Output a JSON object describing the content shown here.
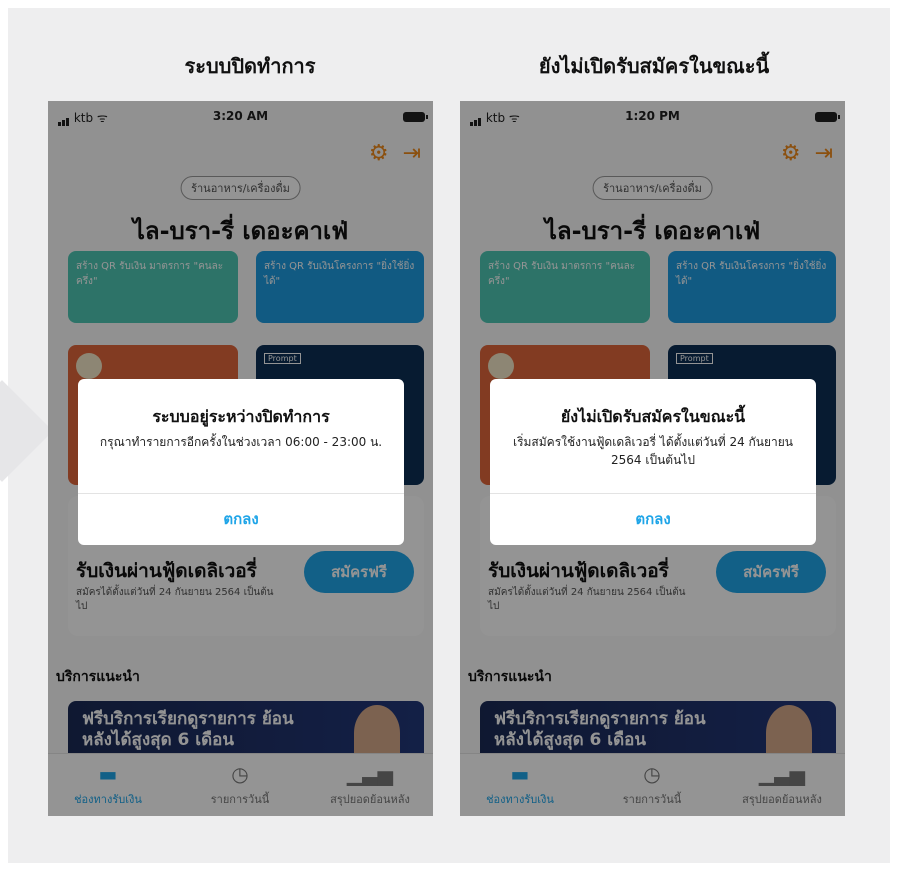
{
  "colors": {
    "accent": "#1fa5e8",
    "orange_icon": "#f08a1a",
    "overlay": "rgba(0,0,0,0.42)"
  },
  "panels": [
    {
      "caption": "ระบบปิดทำการ",
      "status": {
        "carrier": "ktb",
        "time": "3:20 AM"
      },
      "category": "ร้านอาหาร/เครื่องดื่ม",
      "shop_name": "ไล-บรา-รี่ เดอะคาเฟ่",
      "tiles": {
        "green_text": "สร้าง QR รับเงิน มาตรการ \"คนละครึ่ง\"",
        "blue_text": "สร้าง QR รับเงินโครงการ \"ยิ่งใช้ยิ่งได้\"",
        "prompt": "Prompt"
      },
      "delivery": {
        "title": "รับเงินผ่านฟู้ดเดลิเวอรี่",
        "subtitle": "สมัครได้ตั้งแต่วันที่ 24 กันยายน 2564 เป็นต้นไป",
        "button": "สมัครฟรี"
      },
      "section_title": "บริการแนะนำ",
      "promo": "ฟรีบริการเรียกดูรายการ ย้อนหลังได้สูงสุด 6 เดือน",
      "tabs": [
        "ช่องทางรับเงิน",
        "รายการวันนี้",
        "สรุปยอดย้อนหลัง"
      ],
      "dialog": {
        "title": "ระบบอยู่ระหว่างปิดทำการ",
        "message": "กรุณาทำรายการอีกครั้งในช่วงเวลา 06:00 - 23:00 น.",
        "ok": "ตกลง"
      }
    },
    {
      "caption": "ยังไม่เปิดรับสมัครในขณะนี้",
      "status": {
        "carrier": "ktb",
        "time": "1:20 PM"
      },
      "category": "ร้านอาหาร/เครื่องดื่ม",
      "shop_name": "ไล-บรา-รี่ เดอะคาเฟ่",
      "tiles": {
        "green_text": "สร้าง QR รับเงิน มาตรการ \"คนละครึ่ง\"",
        "blue_text": "สร้าง QR รับเงินโครงการ \"ยิ่งใช้ยิ่งได้\"",
        "prompt": "Prompt"
      },
      "delivery": {
        "title": "รับเงินผ่านฟู้ดเดลิเวอรี่",
        "subtitle": "สมัครได้ตั้งแต่วันที่ 24 กันยายน 2564 เป็นต้นไป",
        "button": "สมัครฟรี"
      },
      "section_title": "บริการแนะนำ",
      "promo": "ฟรีบริการเรียกดูรายการ ย้อนหลังได้สูงสุด 6 เดือน",
      "tabs": [
        "ช่องทางรับเงิน",
        "รายการวันนี้",
        "สรุปยอดย้อนหลัง"
      ],
      "dialog": {
        "title": "ยังไม่เปิดรับสมัครในขณะนี้",
        "message": "เริ่มสมัครใช้งานฟู้ดเดลิเวอรี่ ได้ตั้งแต่วันที่ 24 กันยายน 2564 เป็นต้นไป",
        "ok": "ตกลง"
      }
    }
  ]
}
